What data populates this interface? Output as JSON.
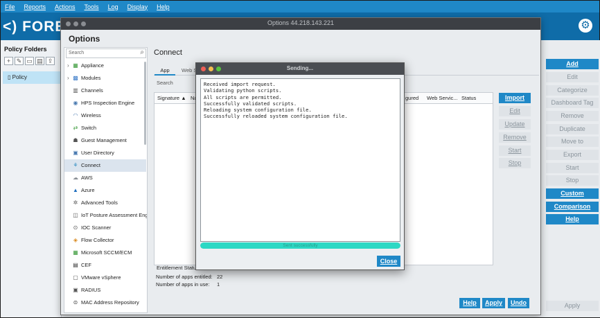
{
  "menu": [
    "File",
    "Reports",
    "Actions",
    "Tools",
    "Log",
    "Display",
    "Help"
  ],
  "brand": "<) FORES",
  "policy_folders": {
    "title": "Policy Folders",
    "item": "Policy"
  },
  "right_actions": [
    {
      "label": "Add",
      "enabled": true
    },
    {
      "label": "Edit",
      "enabled": false
    },
    {
      "label": "Categorize",
      "enabled": false
    },
    {
      "label": "Dashboard Tag",
      "enabled": false
    },
    {
      "label": "Remove",
      "enabled": false
    },
    {
      "label": "Duplicate",
      "enabled": false
    },
    {
      "label": "Move to",
      "enabled": false
    },
    {
      "label": "Export",
      "enabled": false
    },
    {
      "label": "Start",
      "enabled": false
    },
    {
      "label": "Stop",
      "enabled": false
    },
    {
      "label": "Custom",
      "enabled": true
    },
    {
      "label": "Comparison",
      "enabled": true
    },
    {
      "label": "Help",
      "enabled": true
    },
    {
      "label": "Apply",
      "enabled": false
    }
  ],
  "options": {
    "window_title": "Options 44.218.143.221",
    "heading": "Options",
    "search_placeholder": "Search",
    "nav": [
      {
        "label": "Appliance",
        "icon": "appliance-icon",
        "expandable": true
      },
      {
        "label": "Modules",
        "icon": "modules-icon",
        "expandable": true
      },
      {
        "label": "Channels",
        "icon": "channels-icon"
      },
      {
        "label": "HPS Inspection Engine",
        "icon": "hps-icon"
      },
      {
        "label": "Wireless",
        "icon": "wireless-icon"
      },
      {
        "label": "Switch",
        "icon": "switch-icon"
      },
      {
        "label": "Guest Management",
        "icon": "guest-icon"
      },
      {
        "label": "User Directory",
        "icon": "user-directory-icon"
      },
      {
        "label": "Connect",
        "icon": "connect-icon",
        "selected": true
      },
      {
        "label": "AWS",
        "icon": "cloud-icon"
      },
      {
        "label": "Azure",
        "icon": "azure-icon"
      },
      {
        "label": "Advanced Tools",
        "icon": "tools-icon"
      },
      {
        "label": "IoT Posture Assessment Eng",
        "icon": "iot-icon"
      },
      {
        "label": "IOC Scanner",
        "icon": "ioc-icon"
      },
      {
        "label": "Flow Collector",
        "icon": "flow-icon"
      },
      {
        "label": "Microsoft SCCM/ECM",
        "icon": "sccm-icon"
      },
      {
        "label": "CEF",
        "icon": "cef-icon"
      },
      {
        "label": "VMware vSphere",
        "icon": "vmware-icon"
      },
      {
        "label": "RADIUS",
        "icon": "radius-icon"
      },
      {
        "label": "MAC Address Repository",
        "icon": "mac-icon"
      }
    ]
  },
  "connect": {
    "title": "Connect",
    "tabs": [
      "App",
      "Web S"
    ],
    "search_placeholder": "Search",
    "columns": [
      "Signature ▲",
      "Na",
      "gured",
      "Web Servic...",
      "Status"
    ],
    "side_buttons": [
      {
        "label": "Import",
        "enabled": true
      },
      {
        "label": "Edit",
        "enabled": false
      },
      {
        "label": "Update",
        "enabled": false
      },
      {
        "label": "Remove",
        "enabled": false
      },
      {
        "label": "Start",
        "enabled": false
      },
      {
        "label": "Stop",
        "enabled": false
      }
    ],
    "entitlement": {
      "title": "Entitlement Status",
      "rows": [
        {
          "label": "Number of apps entitled:",
          "value": "22"
        },
        {
          "label": "Number of apps in use:",
          "value": "1"
        }
      ]
    },
    "bottom_buttons": [
      "Help",
      "Apply",
      "Undo"
    ]
  },
  "sending": {
    "title": "Sending...",
    "log": [
      "Received import request.",
      "Validating python scripts.",
      "All scripts are permitted.",
      "Successfully validated scripts.",
      "Reloading system configuration file.",
      "Successfully reloaded system configuration file."
    ],
    "progress": 1.0,
    "progress_text": "Sent successfully",
    "close_label": "Close"
  },
  "colors": {
    "accent": "#1f88c7",
    "header": "#0f6ca8",
    "progress": "#2dd8c4"
  }
}
